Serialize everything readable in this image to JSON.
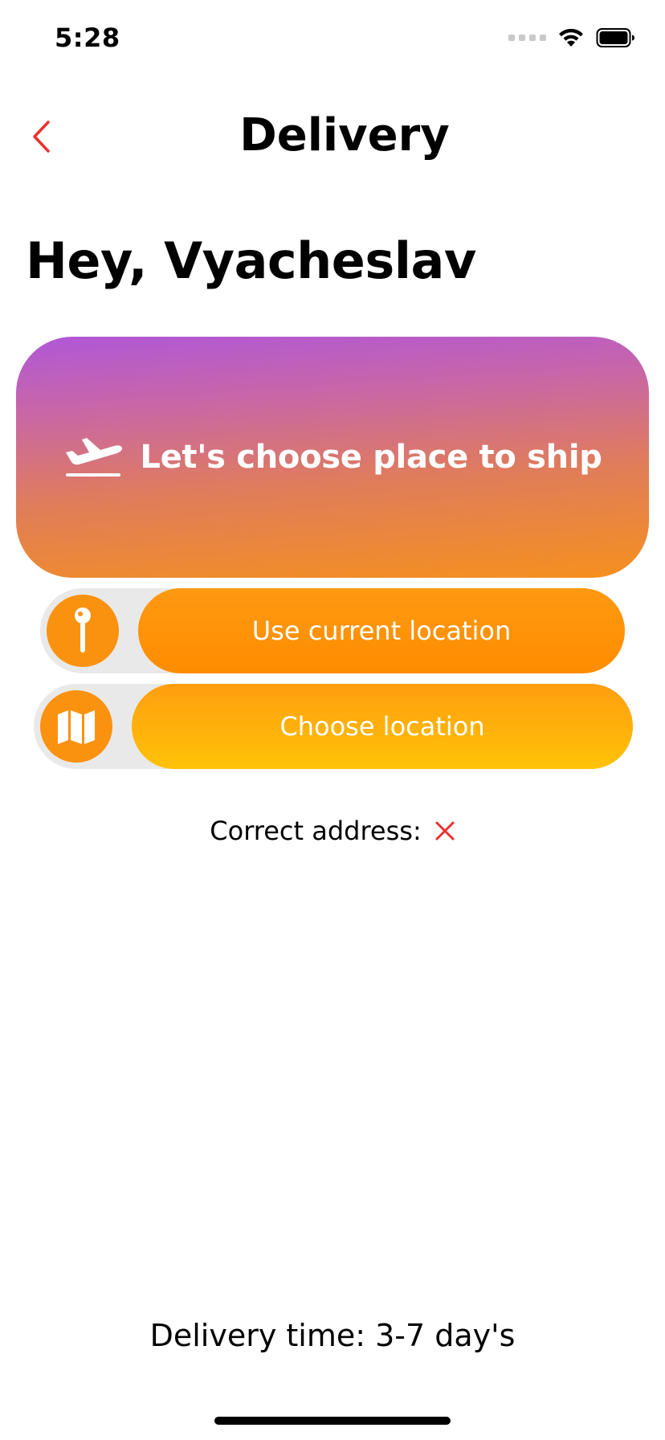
{
  "status": {
    "time": "5:28"
  },
  "nav": {
    "title": "Delivery",
    "back_icon": "chevron-left-icon",
    "accent": "#e8322f"
  },
  "greeting": "Hey, Vyacheslav",
  "hero": {
    "text": "Let's choose place to ship",
    "icon": "airplane-departure-icon"
  },
  "actions": {
    "current_location": {
      "label": "Use current location",
      "icon": "map-pin-icon"
    },
    "choose_location": {
      "label": "Choose location",
      "icon": "folded-map-icon"
    }
  },
  "address": {
    "label": "Correct address:",
    "status_icon": "x-mark-icon",
    "status_color": "#e8322f"
  },
  "footer": {
    "delivery_time": "Delivery time: 3-7 day's"
  },
  "colors": {
    "orange": "#fa9210",
    "yellow": "#ffc207",
    "purple": "#b057d8"
  }
}
